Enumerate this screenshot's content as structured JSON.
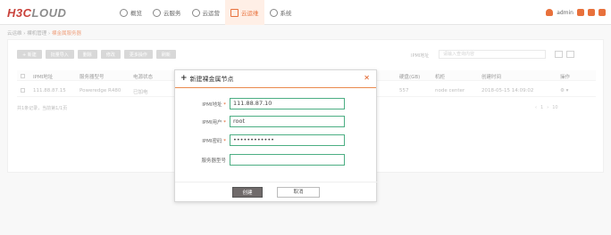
{
  "header": {
    "logo_main": "H3C",
    "logo_sub": "LOUD",
    "nav": [
      {
        "label": "概览",
        "icon": "overview-icon"
      },
      {
        "label": "云服务",
        "icon": "cloud-service-icon"
      },
      {
        "label": "云运营",
        "icon": "cloud-ops-icon"
      },
      {
        "label": "云运维",
        "icon": "cloud-maintenance-icon",
        "active": true
      },
      {
        "label": "系统",
        "icon": "gear-icon"
      }
    ],
    "user": "admin"
  },
  "breadcrumb": {
    "home": "云运维",
    "mid": "裸机管理",
    "current": "裸金属服务器"
  },
  "toolbar": {
    "buttons": [
      "+ 新建",
      "批量导入",
      "删除",
      "修改",
      "更多操作",
      "刷新"
    ],
    "search_label": "IPMI地址",
    "search_placeholder": "请输入查询内容"
  },
  "table": {
    "headers": [
      "IPMI地址",
      "服务器型号",
      "电源状态",
      "",
      "",
      "",
      "硬盘(GB)",
      "机柜",
      "创建时间",
      "操作"
    ],
    "row": [
      "111.88.87.15",
      "Poweredge R480",
      "已加电",
      "",
      "",
      "",
      "557",
      "node center",
      "2018-05-15 14:09:02",
      "⚙ ▾"
    ],
    "footer": "共1条记录，当前第1/1页",
    "pager": [
      "‹",
      "1",
      "›",
      "10"
    ]
  },
  "dialog": {
    "title": "新建裸金属节点",
    "close": "✕",
    "fields": [
      {
        "label": "IPMI地址",
        "required": true,
        "value": "111.88.87.10"
      },
      {
        "label": "IPMI用户",
        "required": true,
        "value": "root"
      },
      {
        "label": "IPMI密码",
        "required": true,
        "value": "••••••••••••"
      },
      {
        "label": "服务器型号",
        "required": false,
        "value": ""
      }
    ],
    "ok": "创建",
    "cancel": "取消"
  },
  "colors": {
    "accent": "#e8713c",
    "logo_red": "#c9413a",
    "input_border": "#4cae83"
  }
}
